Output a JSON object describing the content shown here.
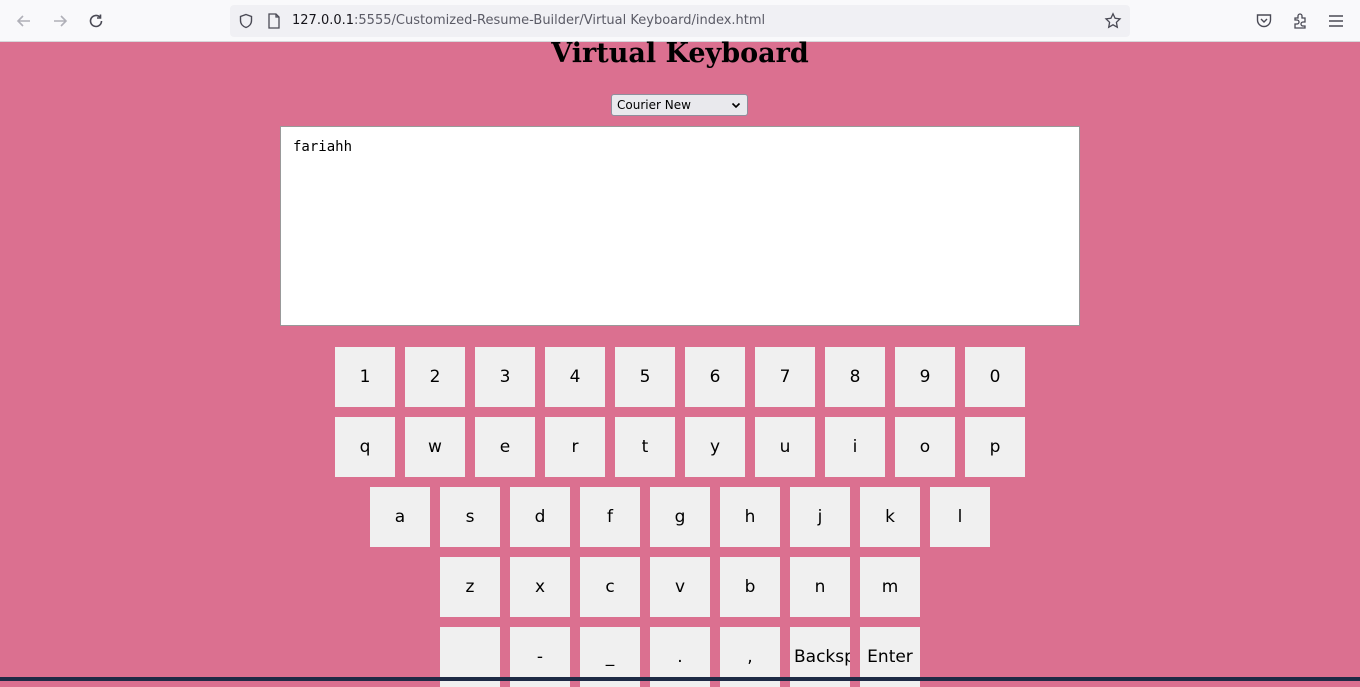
{
  "browser": {
    "url_host": "127.0.0.1",
    "url_rest": ":5555/Customized-Resume-Builder/Virtual Keyboard/index.html"
  },
  "page": {
    "title": "Virtual Keyboard",
    "font_select": {
      "selected": "Courier New"
    },
    "text_value": "fariahh",
    "background_color": "#db7090",
    "key_color": "#f0f0f0"
  },
  "keyboard": {
    "row1": [
      "1",
      "2",
      "3",
      "4",
      "5",
      "6",
      "7",
      "8",
      "9",
      "0"
    ],
    "row2": [
      "q",
      "w",
      "e",
      "r",
      "t",
      "y",
      "u",
      "i",
      "o",
      "p"
    ],
    "row3": [
      "a",
      "s",
      "d",
      "f",
      "g",
      "h",
      "j",
      "k",
      "l"
    ],
    "row4": [
      "z",
      "x",
      "c",
      "v",
      "b",
      "n",
      "m"
    ],
    "row5": [
      "",
      "-",
      "_",
      ".",
      ",",
      "Backspace",
      "Enter"
    ]
  }
}
